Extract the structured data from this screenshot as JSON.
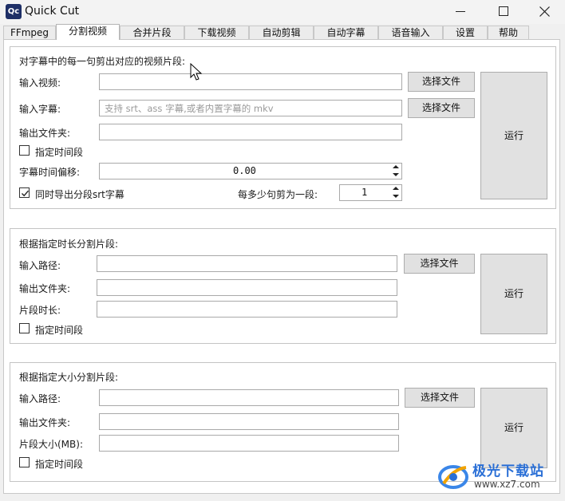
{
  "window": {
    "app_icon_text": "Qc",
    "title": "Quick Cut",
    "controls": {
      "minimize": "minimize",
      "maximize": "maximize",
      "close": "close"
    }
  },
  "tabs": [
    {
      "label": "FFmpeg",
      "active": false
    },
    {
      "label": "分割视频",
      "active": true
    },
    {
      "label": "合并片段",
      "active": false
    },
    {
      "label": "下载视频",
      "active": false
    },
    {
      "label": "自动剪辑",
      "active": false
    },
    {
      "label": "自动字幕",
      "active": false
    },
    {
      "label": "语音输入",
      "active": false
    },
    {
      "label": "设置",
      "active": false
    },
    {
      "label": "帮助",
      "active": false
    }
  ],
  "section_subtitle": {
    "title": "对字幕中的每一句剪出对应的视频片段:",
    "input_video_label": "输入视频:",
    "input_video_value": "",
    "input_subtitle_label": "输入字幕:",
    "input_subtitle_placeholder": "支持 srt、ass 字幕,或者内置字幕的 mkv",
    "output_folder_label": "输出文件夹:",
    "output_folder_value": "",
    "select_file_1": "选择文件",
    "select_file_2": "选择文件",
    "specify_time_label": "指定时间段",
    "specify_time_checked": false,
    "offset_label": "字幕时间偏移:",
    "offset_value": "0.00",
    "export_srt_label": "同时导出分段srt字幕",
    "export_srt_checked": true,
    "per_segment_label": "每多少句剪为一段:",
    "per_segment_value": "1",
    "run_label": "运行"
  },
  "section_duration": {
    "title": "根据指定时长分割片段:",
    "input_path_label": "输入路径:",
    "input_path_value": "",
    "output_folder_label": "输出文件夹:",
    "output_folder_value": "",
    "segment_duration_label": "片段时长:",
    "segment_duration_value": "",
    "select_file": "选择文件",
    "specify_time_label": "指定时间段",
    "specify_time_checked": false,
    "run_label": "运行"
  },
  "section_size": {
    "title": "根据指定大小分割片段:",
    "input_path_label": "输入路径:",
    "input_path_value": "",
    "output_folder_label": "输出文件夹:",
    "output_folder_value": "",
    "segment_size_label": "片段大小(MB):",
    "segment_size_value": "",
    "select_file": "选择文件",
    "specify_time_label": "指定时间段",
    "specify_time_checked": false,
    "run_label": "运行"
  },
  "watermark": {
    "brand": "极光下载站",
    "url": "www.xz7.com"
  },
  "colors": {
    "app_icon_bg": "#1e2f66",
    "watermark_blue": "#2a6fd6",
    "button_bg": "#e1e1e1"
  }
}
